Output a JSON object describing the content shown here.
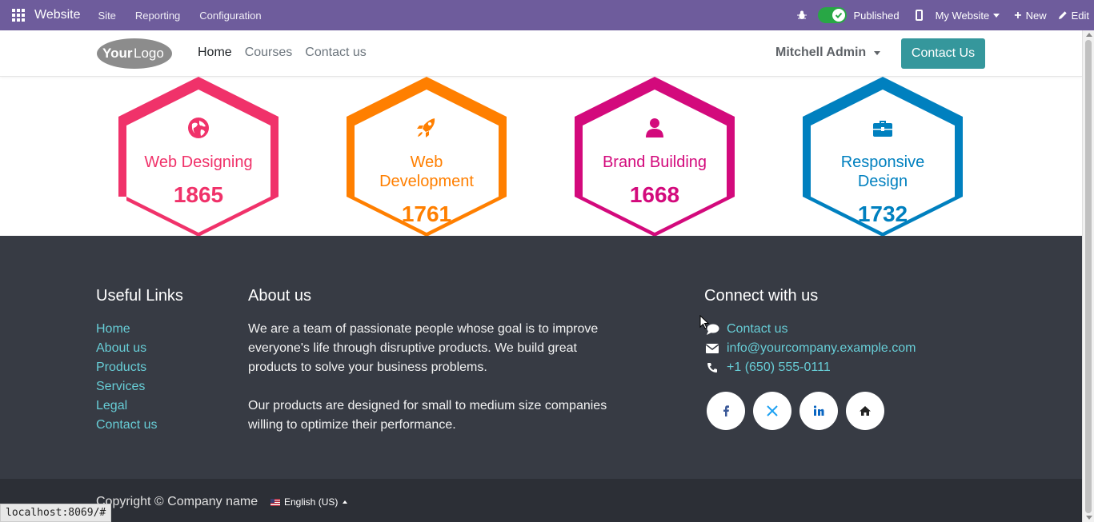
{
  "adminbar": {
    "brand": "Website",
    "menus": [
      "Site",
      "Reporting",
      "Configuration"
    ],
    "published_label": "Published",
    "published": true,
    "website_selector": "My Website",
    "new_label": "New",
    "edit_label": "Edit"
  },
  "header": {
    "logo_text": "YourLogo",
    "nav": [
      "Home",
      "Courses",
      "Contact us"
    ],
    "active_nav": "Home",
    "user": "Mitchell Admin",
    "cta": "Contact Us"
  },
  "counters": [
    {
      "title": "Web Designing",
      "value": "1865",
      "color": "#f0326a",
      "icon": "globe-icon"
    },
    {
      "title": "Web Development",
      "value": "1761",
      "color": "#ff7f00",
      "icon": "rocket-icon"
    },
    {
      "title": "Brand Building",
      "value": "1668",
      "color": "#d30a7c",
      "icon": "user-icon"
    },
    {
      "title": "Responsive Design",
      "value": "1732",
      "color": "#0080bf",
      "icon": "briefcase-icon"
    }
  ],
  "footer": {
    "useful_links_title": "Useful Links",
    "useful_links": [
      "Home",
      "About us",
      "Products",
      "Services",
      "Legal",
      "Contact us"
    ],
    "about_title": "About us",
    "about_p1": "We are a team of passionate people whose goal is to improve everyone's life through disruptive products. We build great products to solve your business problems.",
    "about_p2": "Our products are designed for small to medium size companies willing to optimize their performance.",
    "connect_title": "Connect with us",
    "contact_link": "Contact us",
    "email": "info@yourcompany.example.com",
    "phone": "+1 (650) 555-0111",
    "socials": [
      "facebook-icon",
      "x-icon",
      "linkedin-icon",
      "home-icon"
    ],
    "copyright": "Copyright © Company name",
    "language": "English (US)"
  },
  "status_url": "localhost:8069/#"
}
